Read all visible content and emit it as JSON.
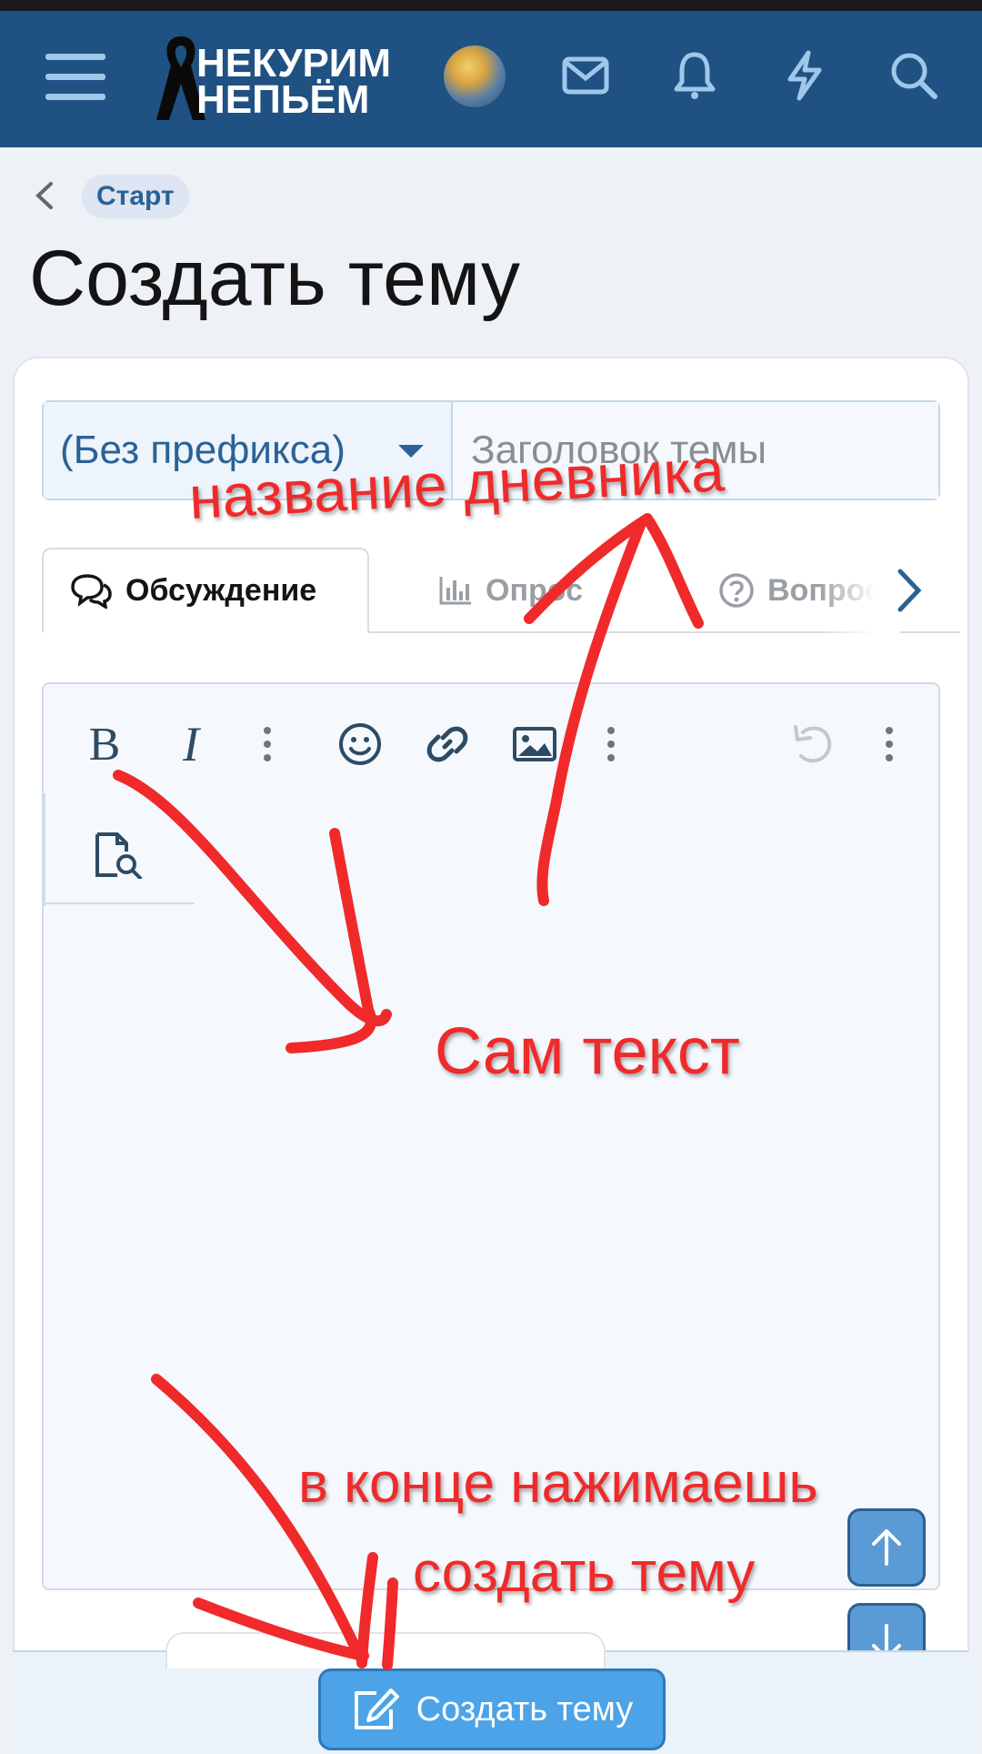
{
  "header": {
    "logo_line1": "НЕКУРИМ",
    "logo_line2": "НЕПЬЁМ",
    "menu_icon": "hamburger-icon",
    "icons": [
      "mail-icon",
      "bell-icon",
      "bolt-icon",
      "search-icon"
    ],
    "bg_color": "#1f5182"
  },
  "breadcrumb": {
    "label": "Старт"
  },
  "page": {
    "title": "Создать тему"
  },
  "form": {
    "prefix_value": "(Без префикса)",
    "title_placeholder": "Заголовок темы",
    "tabs": [
      {
        "label": "Обсуждение",
        "icon": "chat-icon",
        "active": true
      },
      {
        "label": "Опрос",
        "icon": "chart-icon",
        "active": false
      },
      {
        "label": "Вопрос",
        "icon": "question-icon",
        "active": false
      }
    ],
    "toolbar": [
      "bold",
      "italic",
      "more",
      "emoji",
      "link",
      "image",
      "more",
      "undo",
      "more",
      "preview"
    ],
    "submit_label": "Создать тему"
  },
  "annotations": {
    "title_note": "название дневника",
    "body_note": "Сам текст",
    "submit_note_line1": "в конце нажимаешь",
    "submit_note_line2": "создать тему"
  },
  "colors": {
    "accent": "#2a6296",
    "button": "#4ca3e7",
    "annotation": "#f02a2a"
  }
}
